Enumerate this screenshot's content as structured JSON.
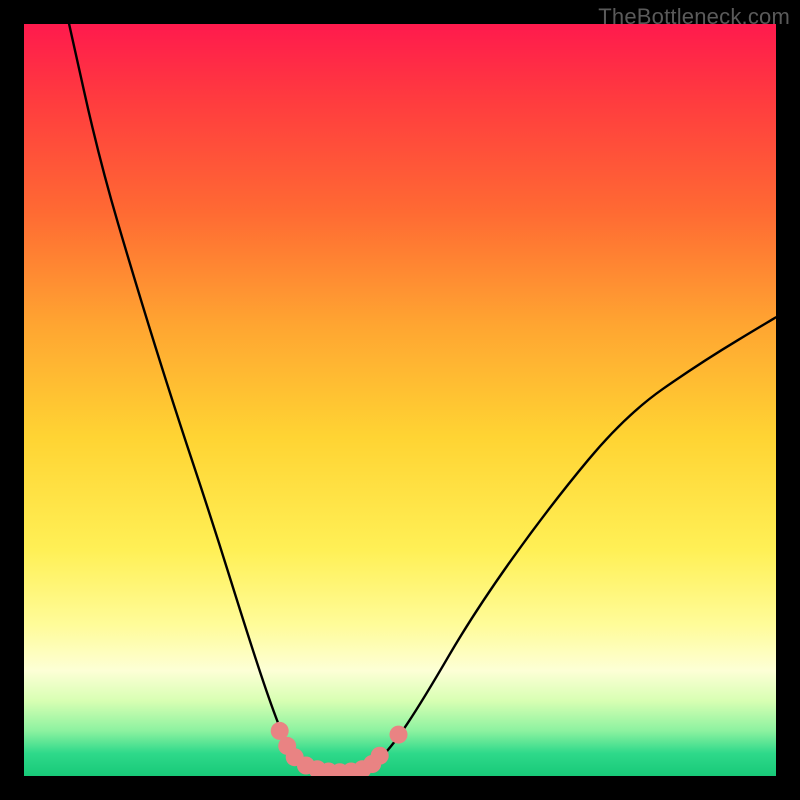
{
  "watermark": "TheBottleneck.com",
  "chart_data": {
    "type": "line",
    "title": "",
    "xlabel": "",
    "ylabel": "",
    "xlim": [
      0,
      100
    ],
    "ylim": [
      0,
      100
    ],
    "background_gradient": [
      "#ff1a4d",
      "#ff3b3f",
      "#ff6a33",
      "#ffa531",
      "#ffd433",
      "#fff056",
      "#fffc9a",
      "#fdffd6",
      "#d8ffb3",
      "#8cf2a0",
      "#2ed98a",
      "#18c978"
    ],
    "series": [
      {
        "name": "bottleneck-curve",
        "color": "#000000",
        "points": [
          {
            "x": 6,
            "y": 100
          },
          {
            "x": 10,
            "y": 82
          },
          {
            "x": 15,
            "y": 65
          },
          {
            "x": 20,
            "y": 49
          },
          {
            "x": 25,
            "y": 34
          },
          {
            "x": 30,
            "y": 18
          },
          {
            "x": 33,
            "y": 9
          },
          {
            "x": 35,
            "y": 4
          },
          {
            "x": 38,
            "y": 1
          },
          {
            "x": 42,
            "y": 0.5
          },
          {
            "x": 46,
            "y": 1
          },
          {
            "x": 49,
            "y": 4
          },
          {
            "x": 53,
            "y": 10
          },
          {
            "x": 60,
            "y": 22
          },
          {
            "x": 70,
            "y": 36
          },
          {
            "x": 80,
            "y": 48
          },
          {
            "x": 90,
            "y": 55
          },
          {
            "x": 100,
            "y": 61
          }
        ]
      },
      {
        "name": "highlight-dots",
        "color": "#e98383",
        "points": [
          {
            "x": 34,
            "y": 6
          },
          {
            "x": 35,
            "y": 4
          },
          {
            "x": 36,
            "y": 2.5
          },
          {
            "x": 37.5,
            "y": 1.4
          },
          {
            "x": 39,
            "y": 0.9
          },
          {
            "x": 40.5,
            "y": 0.6
          },
          {
            "x": 42,
            "y": 0.5
          },
          {
            "x": 43.5,
            "y": 0.6
          },
          {
            "x": 45,
            "y": 0.9
          },
          {
            "x": 46.3,
            "y": 1.6
          },
          {
            "x": 47.3,
            "y": 2.7
          },
          {
            "x": 49.8,
            "y": 5.5
          }
        ]
      }
    ]
  }
}
